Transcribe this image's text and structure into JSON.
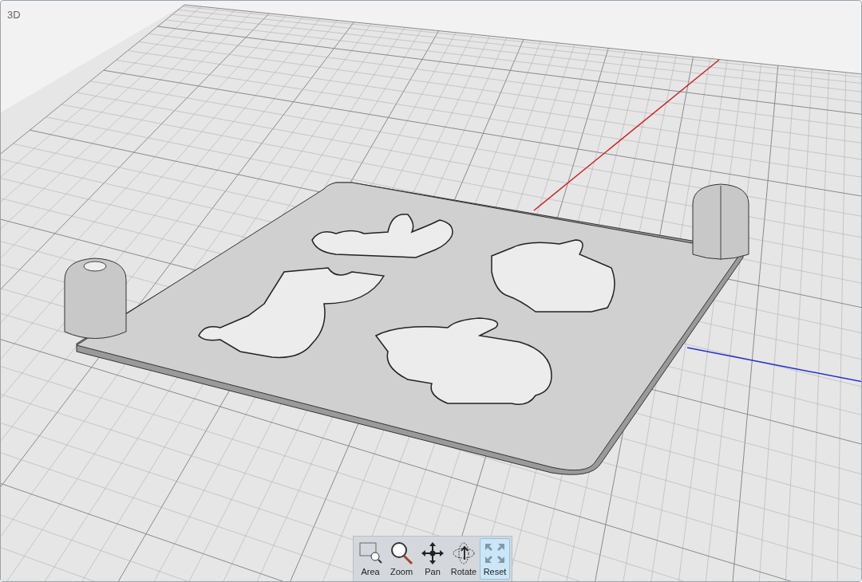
{
  "viewport": {
    "label": "3D"
  },
  "toolbar": [
    {
      "kind": "area",
      "label": "Area",
      "selected": false
    },
    {
      "kind": "zoom",
      "label": "Zoom",
      "selected": false
    },
    {
      "kind": "pan",
      "label": "Pan",
      "selected": false
    },
    {
      "kind": "rotate",
      "label": "Rotate",
      "selected": false
    },
    {
      "kind": "reset",
      "label": "Reset",
      "selected": true
    }
  ]
}
